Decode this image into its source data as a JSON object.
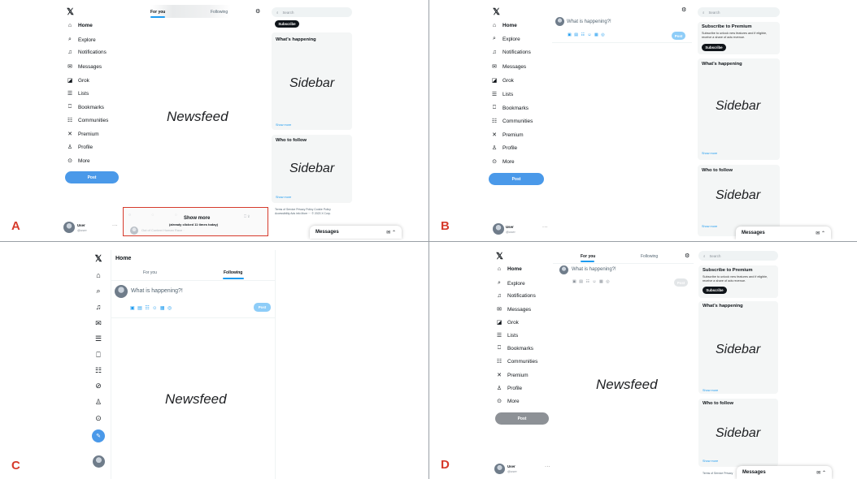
{
  "nav": {
    "home": "Home",
    "explore": "Explore",
    "notifications": "Notifications",
    "messages": "Messages",
    "grok": "Grok",
    "lists": "Lists",
    "bookmarks": "Bookmarks",
    "communities": "Communities",
    "premium": "Premium",
    "profile": "Profile",
    "more": "More",
    "post": "Post"
  },
  "user": {
    "name": "User",
    "handle": "@user",
    "more": "···"
  },
  "search_placeholder": "Search",
  "tabs": {
    "for_you": "For you",
    "following": "Following"
  },
  "compose": {
    "placeholder": "What is happening?!",
    "post": "Post"
  },
  "premium": {
    "title": "Subscribe to Premium",
    "desc": "Subscribe to unlock new features and if eligible, receive a share of ads revenue.",
    "subscribe": "Subscribe"
  },
  "sections": {
    "happening": "What’s happening",
    "follow": "Who to follow",
    "show_more": "Show more"
  },
  "labels": {
    "sidebar": "Sidebar",
    "newsfeed": "Newsfeed"
  },
  "messages_bar": {
    "title": "Messages"
  },
  "footer": {
    "line1": "Terms of Service   Privacy Policy   Cookie Policy",
    "line2": "Accessibility   Ads info   More ···   © 2023 X Corp.",
    "short": "Terms of Service   Privacy"
  },
  "panel_a": {
    "show_more": "Show more",
    "clicked_note": "(already clicked 11 times today)",
    "blur_text": "Out of Context Human Race ·"
  },
  "panel_c": {
    "home_title": "Home"
  },
  "panel_letters": {
    "a": "A",
    "b": "B",
    "c": "C",
    "d": "D"
  },
  "colors": {
    "accent": "#1d9bf0",
    "post_button": "#4a99e9",
    "highlight_red": "#d63a2b"
  }
}
